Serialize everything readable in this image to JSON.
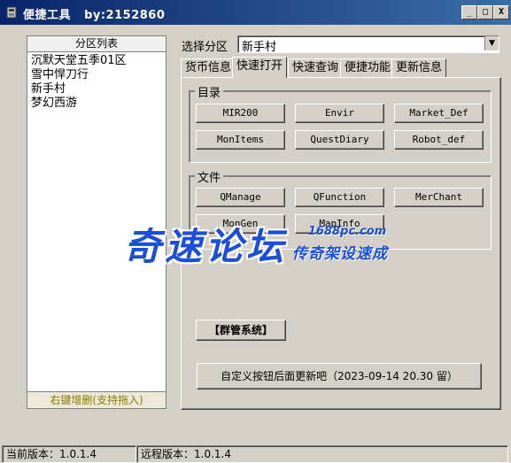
{
  "window": {
    "title": "便捷工具   by:2152860",
    "minimize": "_",
    "maximize": "□",
    "close": "X"
  },
  "region_panel": {
    "header": "分区列表",
    "items": [
      "沉默天堂五季01区",
      "雪中悍刀行",
      "新手村",
      "梦幻西游"
    ],
    "footer": "右键增删(支持拖入)"
  },
  "region_select": {
    "label": "选择分区",
    "value": "新手村",
    "arrow": "▼"
  },
  "tabs": [
    {
      "label": "货币信息"
    },
    {
      "label": "快速打开"
    },
    {
      "label": "快速查询"
    },
    {
      "label": "便捷功能"
    },
    {
      "label": "更新信息"
    }
  ],
  "active_tab": "快速打开",
  "catalog_group": {
    "label": "目录",
    "buttons": [
      "MIR200",
      "Envir",
      "Market_Def",
      "MonItems",
      "QuestDiary",
      "Robot_def"
    ]
  },
  "file_group": {
    "label": "文件",
    "buttons": [
      "QManage",
      "QFunction",
      "MerChant",
      "MonGen",
      "MapInfo"
    ]
  },
  "group_admin_button": "【群管系统】",
  "custom_button": "自定义按钮后面更新吧（2023-09-14 20.30 留）",
  "status": {
    "current_version": "当前版本：1.0.1.4",
    "remote_version": "远程版本：1.0.1.4"
  },
  "watermark": {
    "main": "奇速论坛",
    "url": "1688pc.com",
    "sub": "传奇架设速成"
  }
}
